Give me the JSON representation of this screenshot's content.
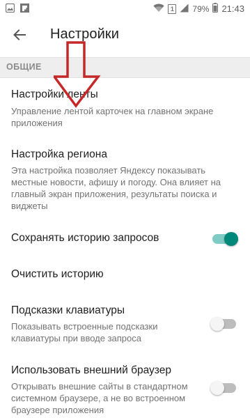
{
  "status_bar": {
    "time": "21:43",
    "battery_percent": "79%",
    "sim_badge": "1"
  },
  "header": {
    "title": "Настройки"
  },
  "section": {
    "label": "ОБЩИЕ"
  },
  "settings": [
    {
      "title": "Настройки ленты",
      "subtitle": "Управление лентой карточек на главном экране приложения"
    },
    {
      "title": "Настройка региона",
      "subtitle": "Эта настройка позволяет Яндексу показывать местные новости, афишу и погоду. Она влияет на главный экран приложения, результаты поиска и виджеты"
    },
    {
      "title": "Сохранять историю запросов",
      "toggle": true
    },
    {
      "title": "Очистить историю"
    },
    {
      "title": "Подсказки клавиатуры",
      "subtitle": "Показывать встроенные подсказки клавиатуры при вводе запроса",
      "toggle": false
    },
    {
      "title": "Использовать внешний браузер",
      "subtitle": "Открывать внешние сайты в стандартном системном браузере, а не во встроенном браузере приложения",
      "toggle": false
    }
  ],
  "colors": {
    "accent": "#00897b",
    "accent_track": "#80cbc4",
    "annotation_arrow": "#c62828"
  }
}
